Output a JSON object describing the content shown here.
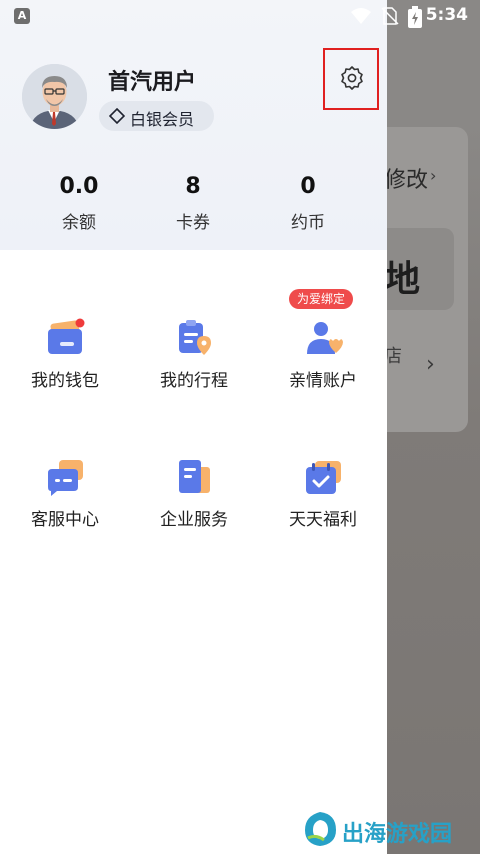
{
  "status_bar": {
    "left_icon_letter": "A",
    "time": "5:34"
  },
  "background_screen": {
    "modify_text": "修改",
    "chevron_1": "›",
    "big_char": "地",
    "small_char": "店",
    "chevron_2": "›"
  },
  "profile": {
    "username": "首汽用户",
    "membership": "白银会员"
  },
  "stats": [
    {
      "value": "0.0",
      "label": "余额"
    },
    {
      "value": "8",
      "label": "卡券"
    },
    {
      "value": "0",
      "label": "约币"
    }
  ],
  "menu": [
    {
      "label": "我的钱包",
      "icon": "wallet-icon",
      "has_dot": true
    },
    {
      "label": "我的行程",
      "icon": "trip-icon"
    },
    {
      "label": "亲情账户",
      "icon": "family-account-icon",
      "badge": "为爱绑定"
    },
    {
      "label": "客服中心",
      "icon": "customer-service-icon"
    },
    {
      "label": "企业服务",
      "icon": "enterprise-icon"
    },
    {
      "label": "天天福利",
      "icon": "daily-benefit-icon"
    }
  ],
  "watermark": {
    "text": "出海游戏园"
  },
  "colors": {
    "highlight_border": "#e02020",
    "promo_badge": "#ef4b4b",
    "watermark": "#27a1c7",
    "icon_blue": "#5a79e8",
    "icon_orange": "#f7b26b"
  }
}
